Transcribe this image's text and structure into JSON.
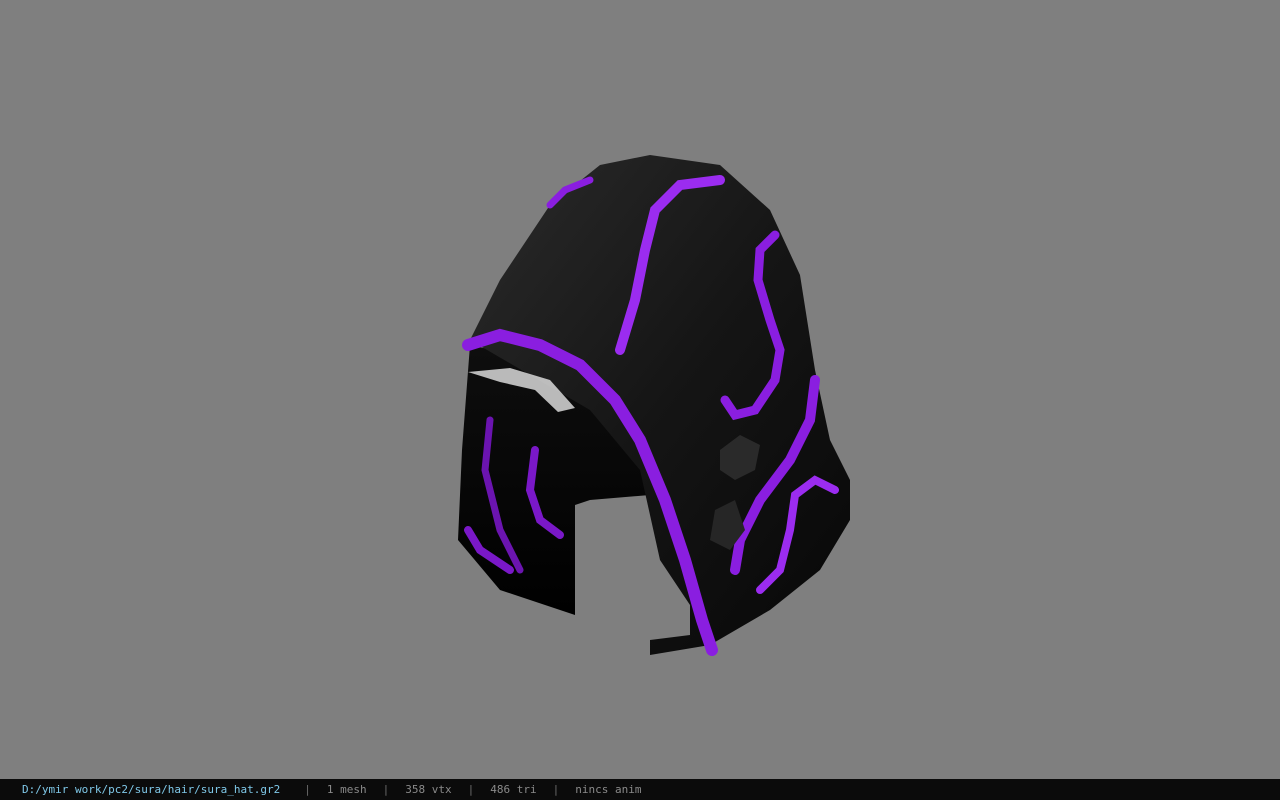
{
  "viewport": {
    "background": "#7f7f7f",
    "model_name": "hood"
  },
  "status": {
    "file_path": "D:/ymir work/pc2/sura/hair/sura_hat.gr2",
    "separator": "|",
    "mesh": "1 mesh",
    "vertices": "358 vtx",
    "triangles": "486 tri",
    "anim": "nincs anim"
  },
  "colors": {
    "path_color": "#7fc8e8",
    "stat_color": "#8a8a8a",
    "hood_black": "#141414",
    "hood_purple": "#8a1ee0"
  }
}
